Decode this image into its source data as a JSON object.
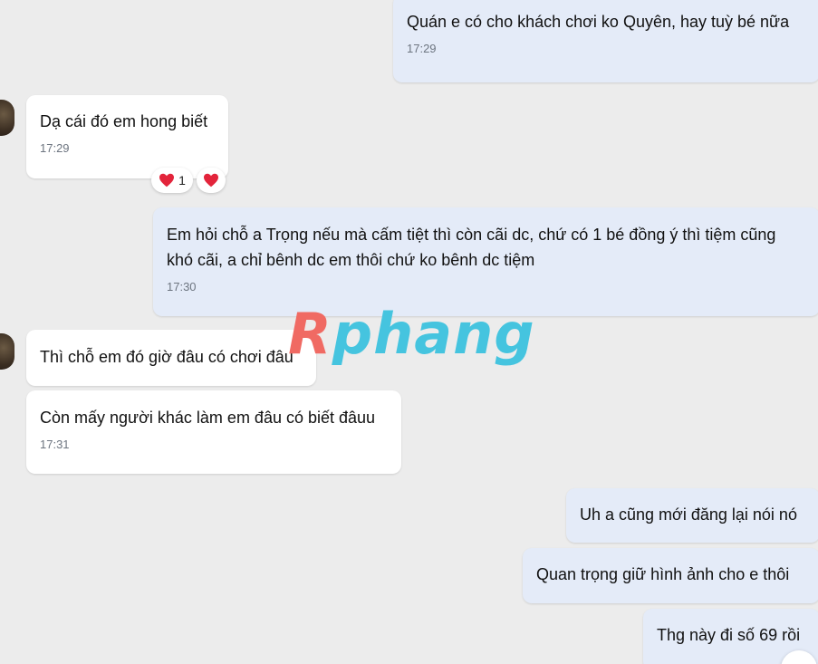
{
  "messages": [
    {
      "direction": "out",
      "text": "Quán e có cho khách chơi ko Quyên, hay tuỳ bé nữa",
      "time": "17:29"
    },
    {
      "direction": "in",
      "text": "Dạ cái đó em hong biết",
      "time": "17:29"
    },
    {
      "direction": "out",
      "text": "Em hỏi chỗ a Trọng nếu mà cấm tiệt thì còn cãi dc, chứ có 1 bé đồng ý thì tiệm cũng\nkhó cãi, a chỉ bênh dc em thôi chứ ko bênh dc tiệm",
      "time": "17:30"
    },
    {
      "direction": "in",
      "text": "Thì chỗ em đó giờ đâu có chơi đâu"
    },
    {
      "direction": "in",
      "text": "Còn mấy người khác làm em đâu có biết đâuu",
      "time": "17:31"
    },
    {
      "direction": "out",
      "text": "Uh a cũng mới đăng lại nói nó"
    },
    {
      "direction": "out",
      "text": "Quan trọng giữ hình ảnh cho e thôi"
    },
    {
      "direction": "out",
      "text": "Thg này đi số 69 rồi"
    }
  ],
  "reactions": {
    "summary_count": "1",
    "icon": "heart-icon",
    "color": "#e3243b"
  },
  "watermark": {
    "first": "R",
    "rest": "phang"
  },
  "colors": {
    "background": "#ececec",
    "incoming_bubble": "#ffffff",
    "outgoing_bubble": "#e4ebf8",
    "time_text": "#6d7580"
  }
}
